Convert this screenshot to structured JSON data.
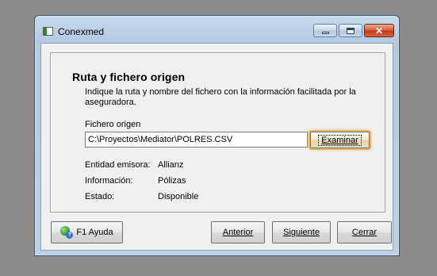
{
  "window": {
    "title": "Conexmed",
    "close_glyph": "✕"
  },
  "panel": {
    "heading": "Ruta y fichero origen",
    "description": "Indique la ruta y nombre del fichero con la información facilitada por la aseguradora.",
    "file_label": "Fichero origen",
    "file_value": "C:\\Proyectos\\Mediator\\POLRES.CSV",
    "browse_label": "Examinar",
    "info": [
      {
        "key": "Entidad emisora:",
        "value": "Allianz"
      },
      {
        "key": "Información:",
        "value": "Pólizas"
      },
      {
        "key": "Estado:",
        "value": "Disponible"
      }
    ]
  },
  "footer": {
    "help_label": "F1 Ayuda",
    "prev_label": "Anterior",
    "next_label": "Siguiente",
    "close_label": "Cerrar"
  },
  "icons": {
    "window_icon": "app-window-icon",
    "help_icon": "help-globe-icon"
  }
}
